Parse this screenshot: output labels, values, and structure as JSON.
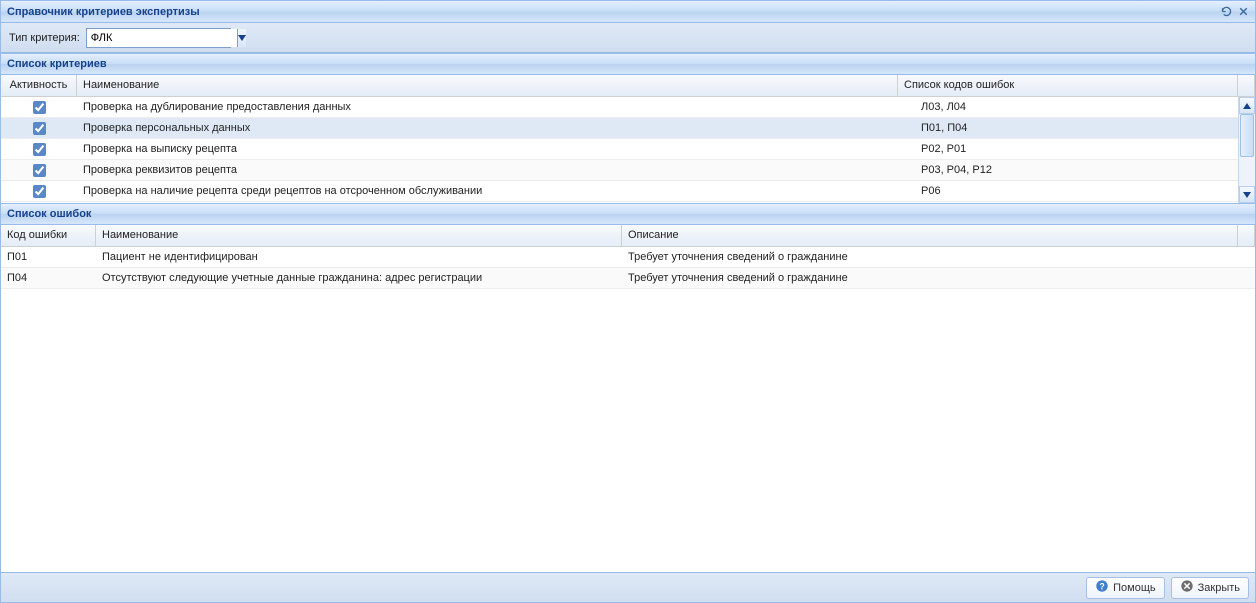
{
  "window": {
    "title": "Справочник критериев экспертизы"
  },
  "toolbar": {
    "type_label": "Тип критерия:",
    "type_value": "ФЛК"
  },
  "criteria": {
    "section_title": "Список критериев",
    "columns": {
      "activity": "Активность",
      "name": "Наименование",
      "codes": "Список кодов ошибок"
    },
    "rows": [
      {
        "active": true,
        "name": "Проверка на дублирование предоставления данных",
        "codes": "Л03, Л04"
      },
      {
        "active": true,
        "name": "Проверка персональных данных",
        "codes": "П01, П04"
      },
      {
        "active": true,
        "name": "Проверка на выписку рецепта",
        "codes": "Р02, Р01"
      },
      {
        "active": true,
        "name": "Проверка реквизитов рецепта",
        "codes": "Р03, Р04, Р12"
      },
      {
        "active": true,
        "name": "Проверка на наличие рецепта среди рецептов на отсроченном обслуживании",
        "codes": "Р06"
      }
    ],
    "selected_index": 1
  },
  "errors": {
    "section_title": "Список ошибок",
    "columns": {
      "code": "Код ошибки",
      "name": "Наименование",
      "desc": "Описание"
    },
    "rows": [
      {
        "code": "П01",
        "name": "Пациент не идентифицирован",
        "desc": "Требует уточнения сведений о гражданине"
      },
      {
        "code": "П04",
        "name": "Отсутствуют следующие учетные данные гражданина: адрес регистрации",
        "desc": "Требует уточнения сведений о гражданине"
      }
    ]
  },
  "footer": {
    "help_label": "Помощь",
    "close_label": "Закрыть"
  }
}
